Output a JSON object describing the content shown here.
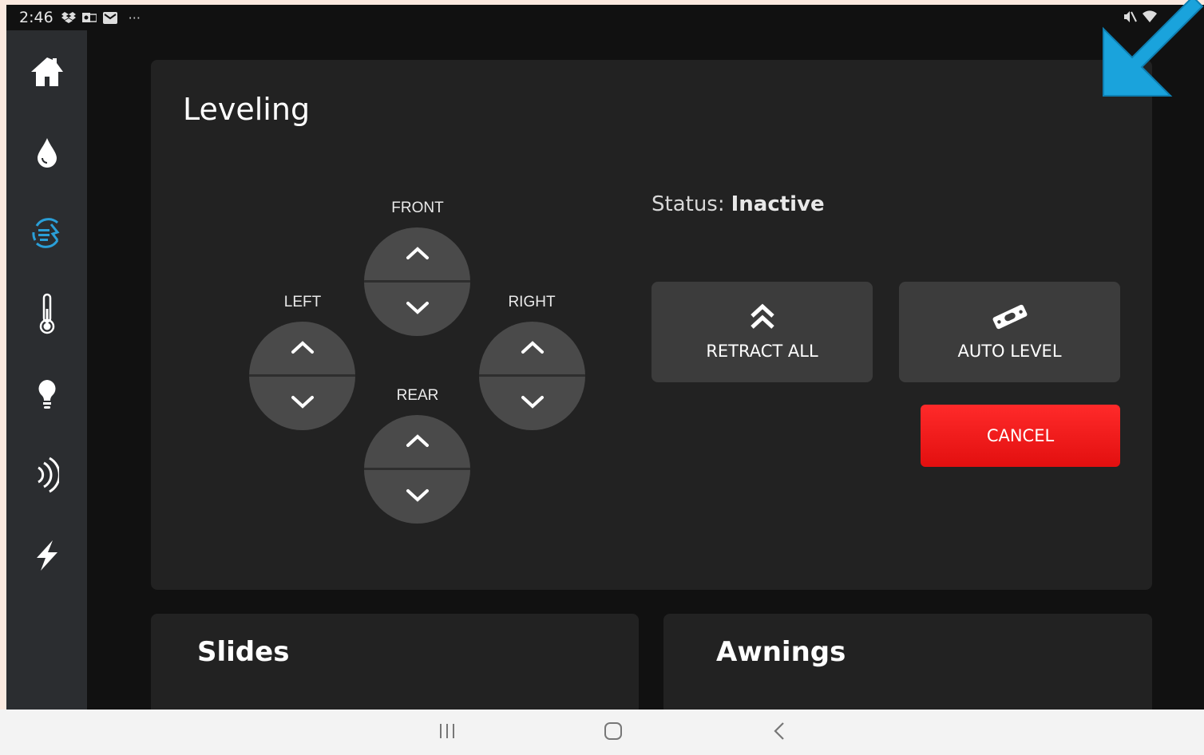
{
  "status_bar": {
    "time": "2:46",
    "left_icons": [
      "dropbox-icon",
      "outlook-icon",
      "mail-icon",
      "more-icon"
    ],
    "right_icons": [
      "mute-icon",
      "wifi-icon"
    ]
  },
  "sidebar": {
    "items": [
      {
        "name": "home",
        "icon": "home-icon",
        "active": false
      },
      {
        "name": "water",
        "icon": "water-drop-icon",
        "active": false
      },
      {
        "name": "leveling",
        "icon": "leveling-icon",
        "active": true
      },
      {
        "name": "temperature",
        "icon": "thermometer-icon",
        "active": false
      },
      {
        "name": "lights",
        "icon": "lightbulb-icon",
        "active": false
      },
      {
        "name": "sound",
        "icon": "sound-waves-icon",
        "active": false
      },
      {
        "name": "power",
        "icon": "lightning-icon",
        "active": false
      }
    ],
    "active_color": "#2a9fd8"
  },
  "leveling": {
    "title": "Leveling",
    "labels": {
      "front": "FRONT",
      "left": "LEFT",
      "right": "RIGHT",
      "rear": "REAR"
    },
    "status_label": "Status:",
    "status_value": "Inactive",
    "retract_label": "RETRACT ALL",
    "auto_level_label": "AUTO LEVEL",
    "cancel_label": "CANCEL"
  },
  "slides": {
    "title": "Slides"
  },
  "awnings": {
    "title": "Awnings"
  },
  "colors": {
    "cancel": "#ff1f1f",
    "annotation_arrow": "#1aa3dc"
  },
  "nav": {
    "buttons": [
      "recents-icon",
      "home-nav-icon",
      "back-icon"
    ]
  }
}
